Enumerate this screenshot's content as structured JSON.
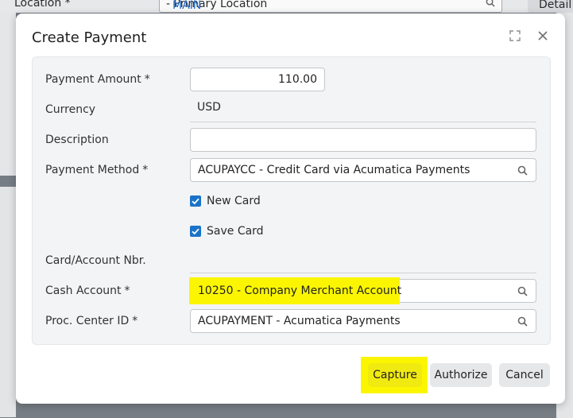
{
  "background": {
    "location_label": "Location *",
    "location_code": "MAIN",
    "location_name": " - Primary Location",
    "detail_tab": "Detail"
  },
  "dialog": {
    "title": "Create Payment",
    "fields": {
      "payment_amount": {
        "label": "Payment Amount",
        "value": "110.00"
      },
      "currency": {
        "label": "Currency",
        "value": "USD"
      },
      "description": {
        "label": "Description",
        "value": ""
      },
      "payment_method": {
        "label": "Payment Method",
        "value": "ACUPAYCC - Credit Card via Acumatica Payments"
      },
      "new_card": {
        "label": "New Card",
        "checked": true
      },
      "save_card": {
        "label": "Save Card",
        "checked": true
      },
      "card_account_nbr": {
        "label": "Card/Account Nbr.",
        "value": ""
      },
      "cash_account": {
        "label": "Cash Account",
        "value": "10250 - Company Merchant Account"
      },
      "proc_center": {
        "label": "Proc. Center ID",
        "value": "ACUPAYMENT - Acumatica Payments"
      }
    },
    "required_marker": "*",
    "buttons": {
      "capture": "Capture",
      "authorize": "Authorize",
      "cancel": "Cancel"
    }
  },
  "colors": {
    "highlight": "#fbf600",
    "checkbox": "#1a73c8",
    "accent_link": "#2167c5"
  }
}
